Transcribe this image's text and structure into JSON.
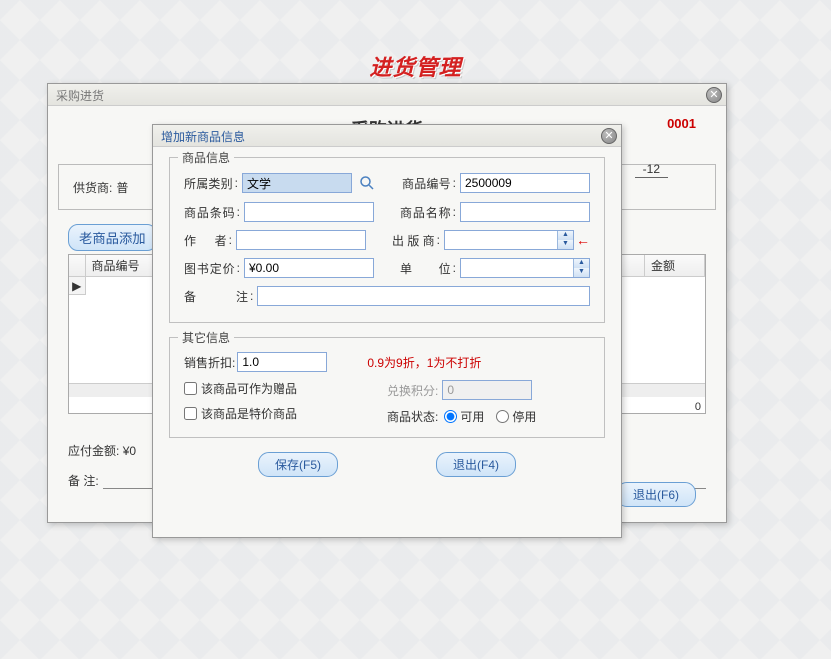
{
  "page_heading": "进货管理",
  "bg_window": {
    "title": "采购进货",
    "heading": "采购进货",
    "order_label_partial": "0001",
    "supplier_label": "供货商:",
    "supplier_value_partial": "普",
    "date_partial": "-12",
    "old_goods_button": "老商品添加",
    "grid_headers": {
      "col1": "商品编号",
      "col_last": "金额"
    },
    "grid_footer_count": "0",
    "pay_label": "应付金额:",
    "pay_value_partial": "¥0",
    "memo_label": "备    注:",
    "exit_button": "退出(F6)"
  },
  "fg_window": {
    "title": "增加新商品信息",
    "group1_label": "商品信息",
    "fields": {
      "category_label": "所属类别",
      "category_value": "文学",
      "barcode_label": "商品条码",
      "author_label": "作    者",
      "price_label": "图书定价",
      "price_value": "¥0.00",
      "memo_label": "备    注",
      "code_label": "商品编号",
      "code_value": "2500009",
      "name_label": "商品名称",
      "publisher_label": "出 版 商",
      "unit_label": "单      位"
    },
    "group2_label": "其它信息",
    "other": {
      "discount_label": "销售折扣:",
      "discount_value": "1.0",
      "discount_hint": "0.9为9折，1为不打折",
      "gift_checkbox": "该商品可作为赠品",
      "special_checkbox": "该商品是特价商品",
      "points_label": "兑换积分:",
      "points_value": "0",
      "status_label": "商品状态:",
      "status_available": "可用",
      "status_disabled": "停用"
    },
    "save_button": "保存(F5)",
    "exit_button": "退出(F4)"
  }
}
